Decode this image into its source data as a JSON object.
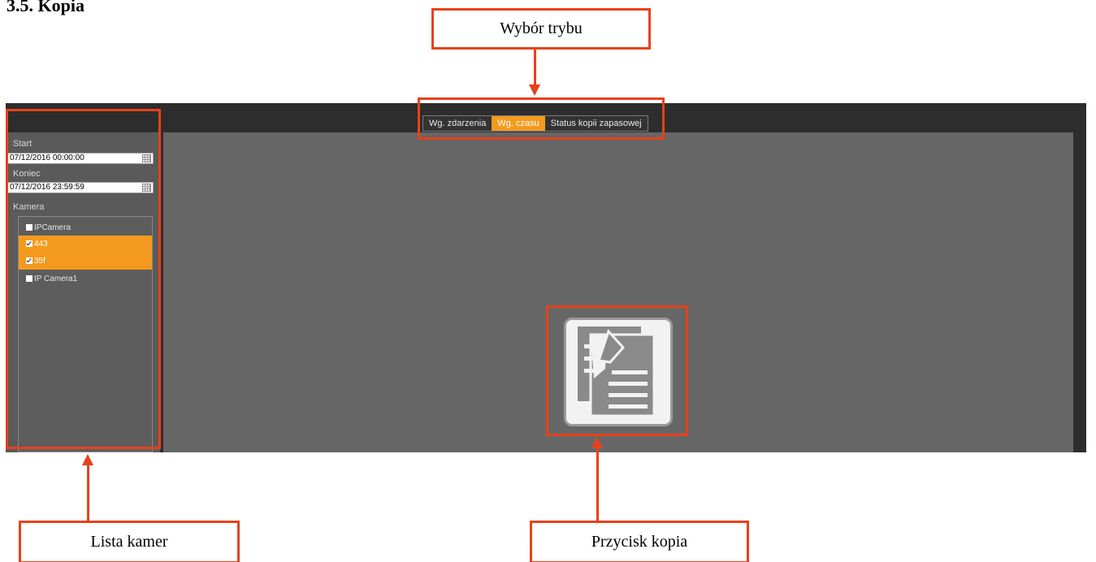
{
  "heading": "3.5. Kopia",
  "mode_tabs": [
    {
      "label": "Wg. zdarzenia",
      "active": false
    },
    {
      "label": "Wg. czasu",
      "active": true
    },
    {
      "label": "Status kopii zapasowej",
      "active": false
    }
  ],
  "filters": {
    "start_label": "Start",
    "start_value": "07/12/2016 00:00:00",
    "end_label": "Koniec",
    "end_value": "07/12/2016 23:59:59",
    "camera_label": "Kamera"
  },
  "cameras": [
    {
      "name": "IPCamera",
      "checked": false
    },
    {
      "name": "443",
      "checked": true
    },
    {
      "name": "35f",
      "checked": true
    },
    {
      "name": "IP Camera1",
      "checked": false
    }
  ],
  "annotations": {
    "mode_select": "Wybór trybu",
    "camera_list": "Lista kamer",
    "backup_button": "Przycisk kopia"
  },
  "colors": {
    "accent": "#f39a1e",
    "annotation": "#e8411b",
    "main_area": "#666666",
    "header": "#2d2d2d"
  },
  "icons": {
    "backup_button": "document-copy-icon",
    "date_picker": "calendar-icon",
    "checkbox": "checkbox-icon"
  }
}
